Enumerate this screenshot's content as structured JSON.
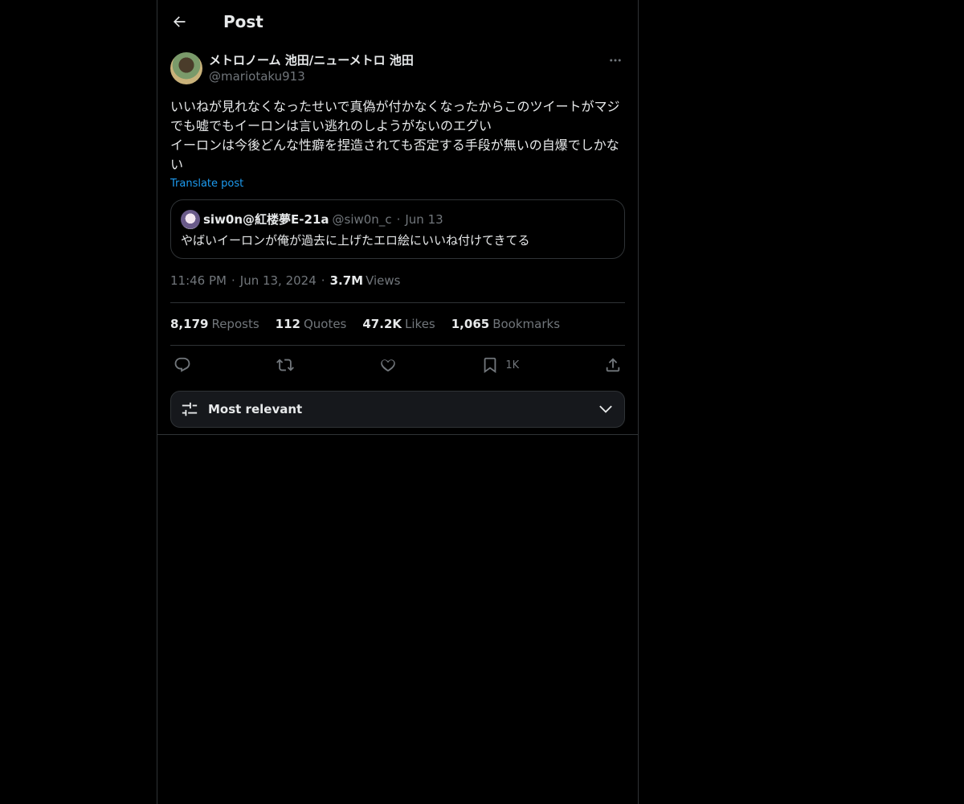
{
  "header": {
    "title": "Post"
  },
  "author": {
    "display_name": "メトロノーム 池田/ニューメトロ 池田",
    "handle": "@mariotaku913"
  },
  "tweet": {
    "text": "いいねが見れなくなったせいで真偽が付かなくなったからこのツイートがマジでも嘘でもイーロンは言い逃れのしようがないのエグい\nイーロンは今後どんな性癖を捏造されても否定する手段が無いの自爆でしかない",
    "translate_label": "Translate post"
  },
  "quote": {
    "display_name": "siw0n@紅楼夢E-21a",
    "handle": "@siw0n_c",
    "date": "Jun 13",
    "text": "やばいイーロンが俺が過去に上げたエロ絵にいいね付けてきてる"
  },
  "meta": {
    "time": "11:46 PM",
    "date": "Jun 13, 2024",
    "views_count": "3.7M",
    "views_label": "Views"
  },
  "stats": {
    "reposts": {
      "count": "8,179",
      "label": "Reposts"
    },
    "quotes": {
      "count": "112",
      "label": "Quotes"
    },
    "likes": {
      "count": "47.2K",
      "label": "Likes"
    },
    "bookmarks": {
      "count": "1,065",
      "label": "Bookmarks"
    }
  },
  "actions": {
    "bookmark_count": "1K"
  },
  "sort": {
    "label": "Most relevant"
  },
  "icons": {
    "back": "arrow-left-icon",
    "more": "more-horizontal-icon",
    "reply": "reply-icon",
    "repost": "repost-icon",
    "like": "heart-icon",
    "bookmark": "bookmark-icon",
    "share": "share-icon",
    "sort": "sliders-icon",
    "chevron": "chevron-down-icon"
  },
  "colors": {
    "background": "#000000",
    "text": "#e7e9ea",
    "secondary": "#71767b",
    "accent": "#1d9bf0",
    "border": "#2f3336"
  }
}
